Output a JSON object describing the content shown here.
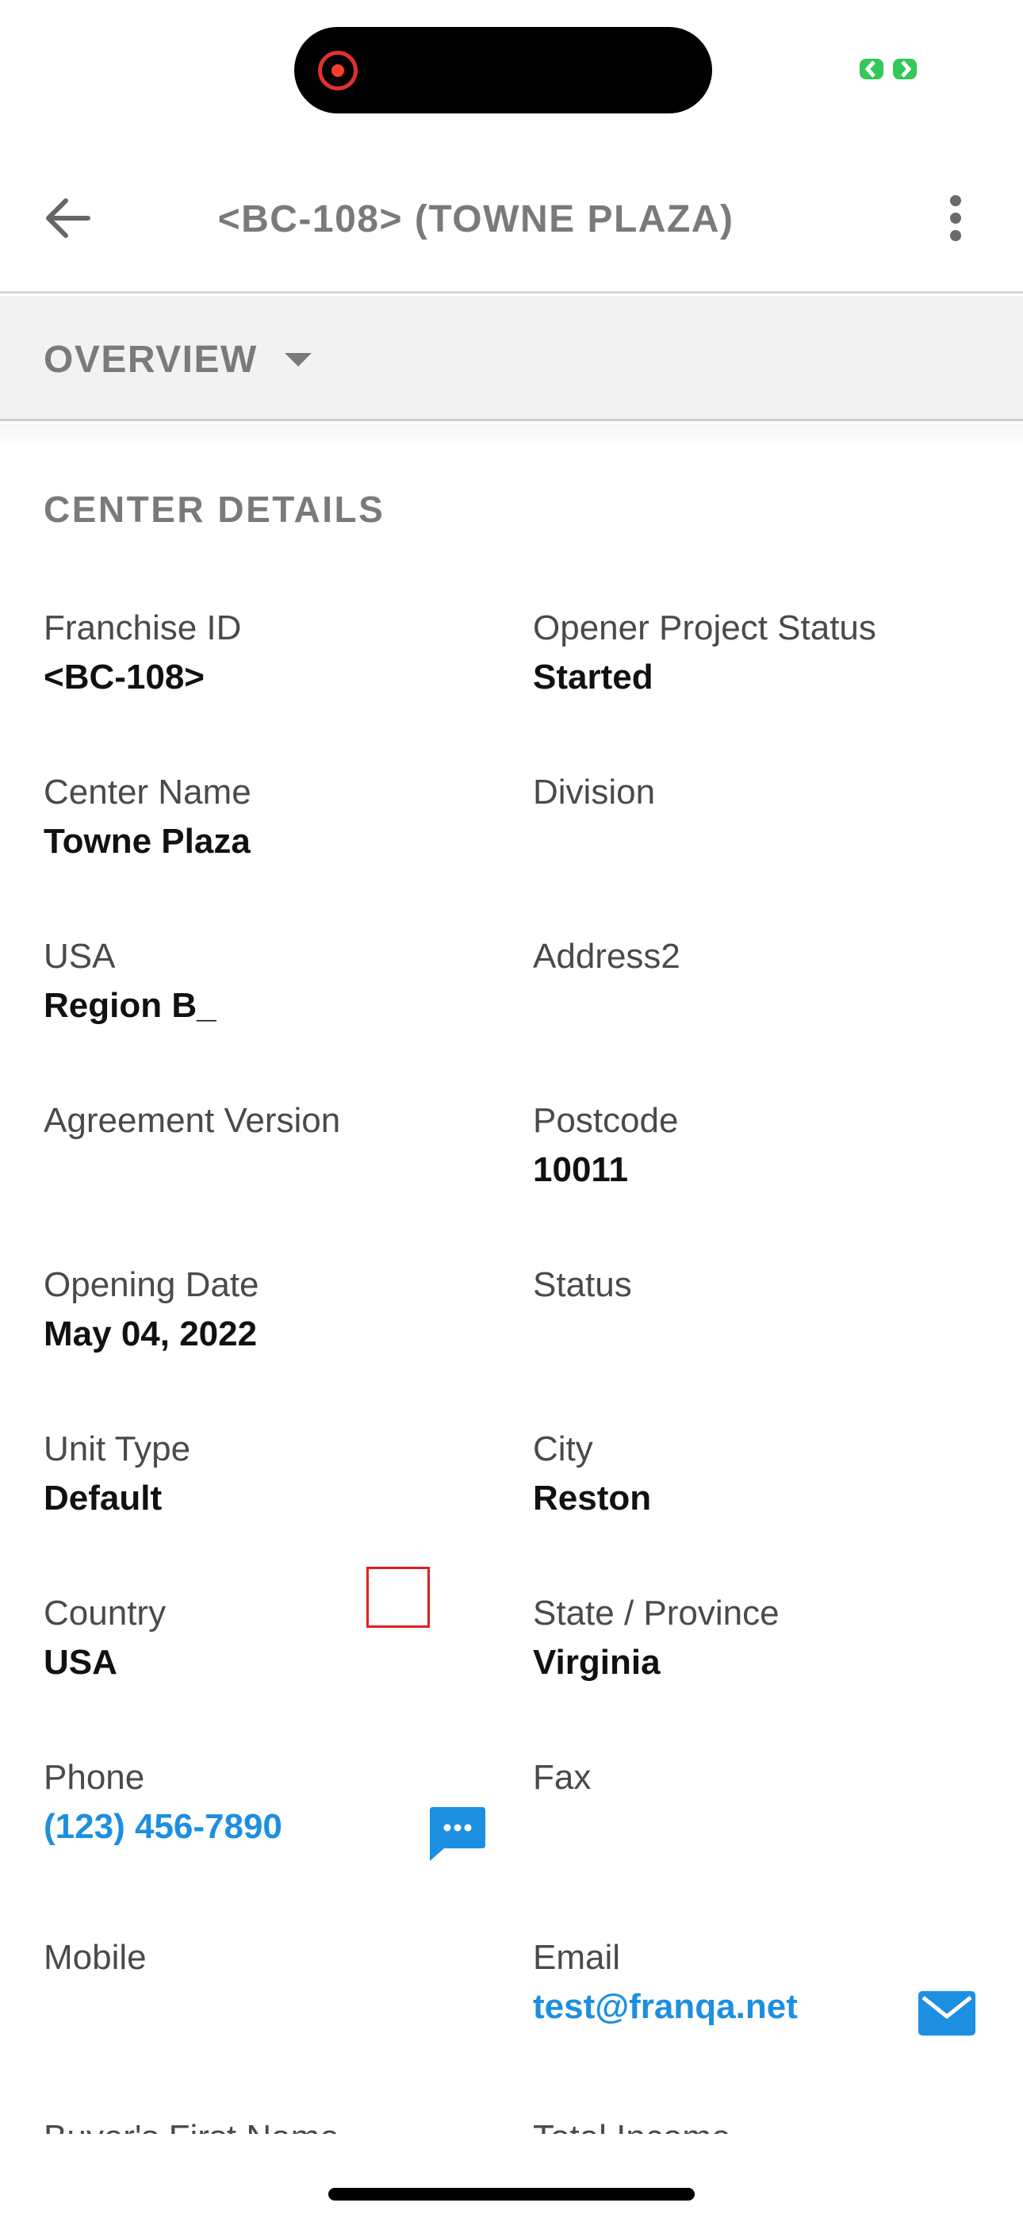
{
  "header": {
    "title": "<BC-108> (TOWNE PLAZA)",
    "back_icon": "arrow-left-icon",
    "more_icon": "vertical-dots-icon"
  },
  "section_selector": {
    "label": "OVERVIEW",
    "icon": "caret-down-icon"
  },
  "section": {
    "heading": "CENTER DETAILS"
  },
  "fields": {
    "franchise_id": {
      "label": "Franchise ID",
      "value": "<BC-108>"
    },
    "opener_project_status": {
      "label": "Opener Project Status",
      "value": "Started"
    },
    "center_name": {
      "label": "Center Name",
      "value": "Towne Plaza"
    },
    "division": {
      "label": "Division",
      "value": ""
    },
    "usa": {
      "label": "USA",
      "value": "Region B_"
    },
    "address2": {
      "label": "Address2",
      "value": ""
    },
    "agreement_version": {
      "label": "Agreement Version",
      "value": ""
    },
    "postcode": {
      "label": "Postcode",
      "value": "10011"
    },
    "opening_date": {
      "label": "Opening Date",
      "value": "May 04, 2022"
    },
    "status": {
      "label": "Status",
      "value": ""
    },
    "unit_type": {
      "label": "Unit Type",
      "value": "Default"
    },
    "city": {
      "label": "City",
      "value": "Reston"
    },
    "country": {
      "label": "Country",
      "value": "USA"
    },
    "state_province": {
      "label": "State / Province",
      "value": "Virginia"
    },
    "phone": {
      "label": "Phone",
      "value": "(123) 456-7890"
    },
    "fax": {
      "label": "Fax",
      "value": ""
    },
    "mobile": {
      "label": "Mobile",
      "value": ""
    },
    "email": {
      "label": "Email",
      "value": "test@franqa.net"
    },
    "buyers_first_name": {
      "label": "Buyer's First Name"
    },
    "total_income": {
      "label": "Total Income"
    }
  },
  "icons": {
    "message": "chat-bubble-icon",
    "email": "envelope-icon"
  },
  "colors": {
    "link": "#1d8fe0",
    "label": "#4a4a4a",
    "value": "#111111",
    "header_text": "#7a7a7a",
    "section_bar": "#f2f2f2",
    "status_green": "#34c759",
    "focus_outline": "#e02020"
  }
}
